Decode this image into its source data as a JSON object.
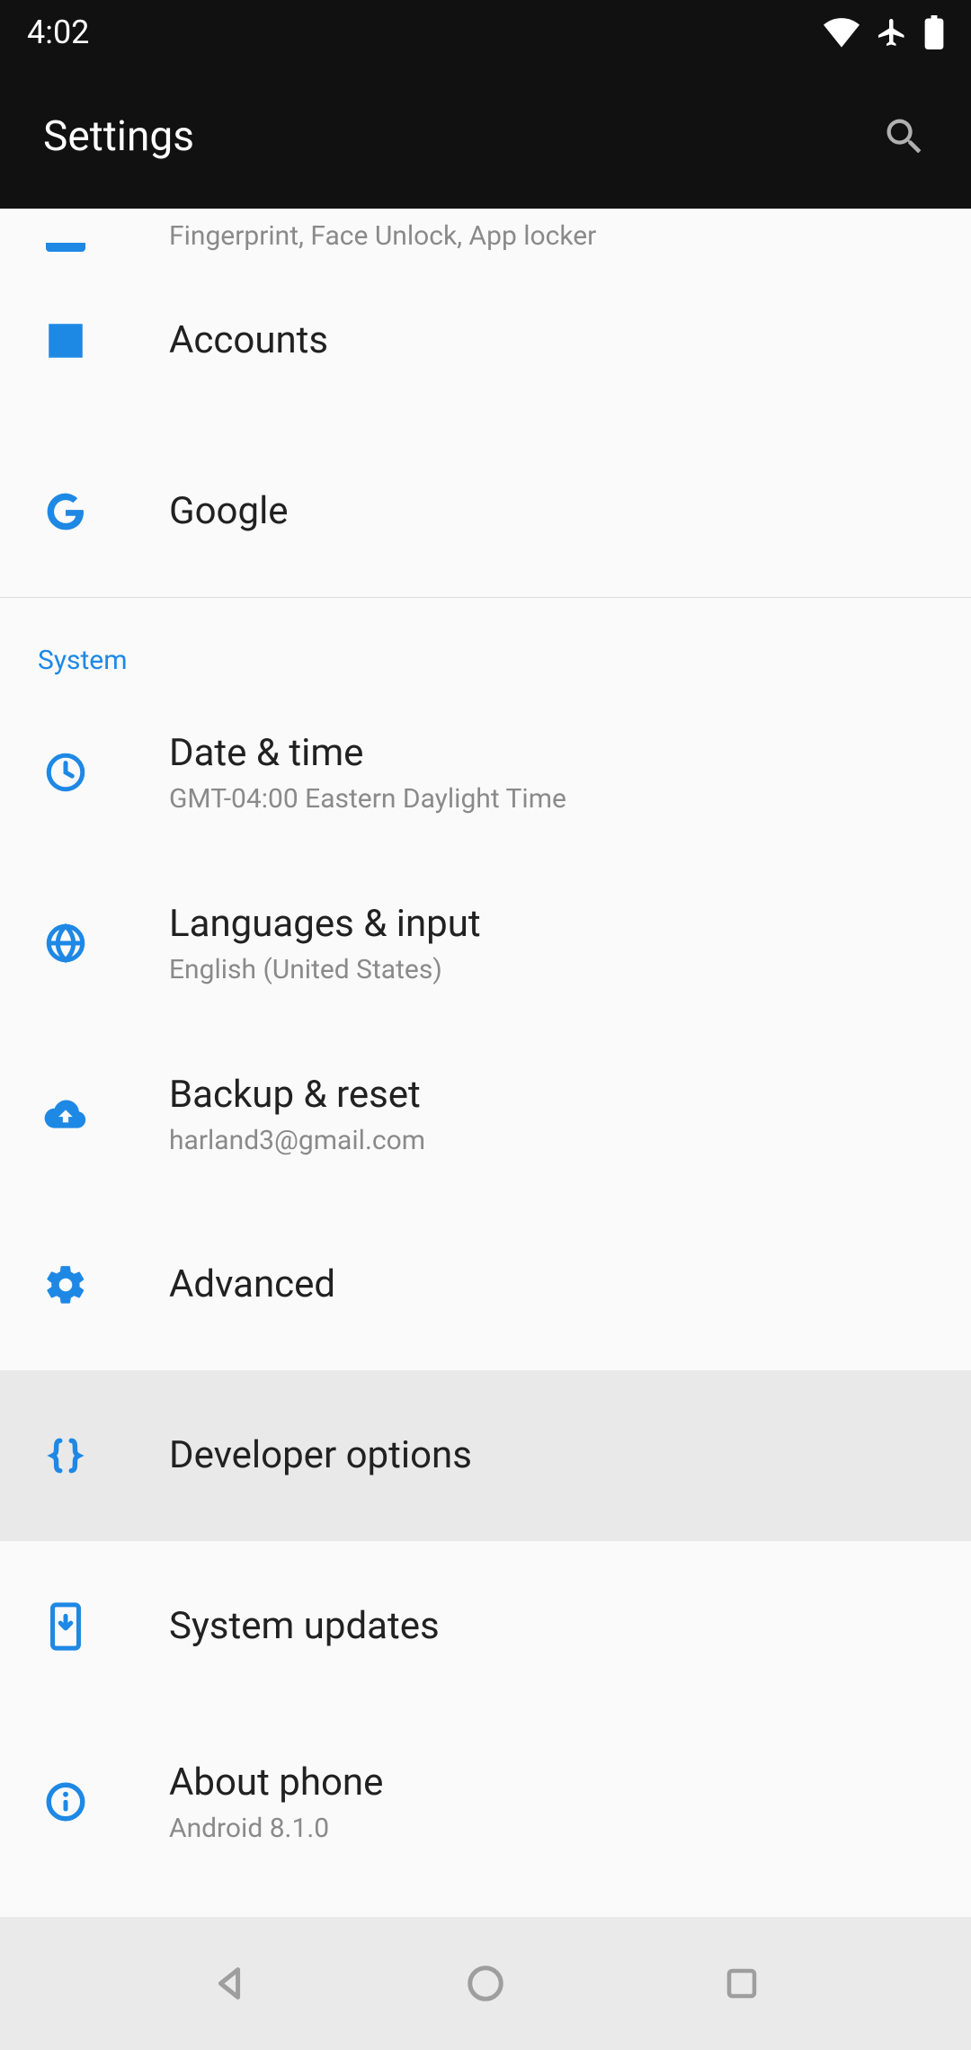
{
  "statusbar": {
    "time": "4:02"
  },
  "appbar": {
    "title": "Settings"
  },
  "partial_item": {
    "subtitle": "Fingerprint, Face Unlock, App locker"
  },
  "items": {
    "accounts": {
      "title": "Accounts"
    },
    "google": {
      "title": "Google"
    },
    "datetime": {
      "title": "Date & time",
      "subtitle": "GMT-04:00 Eastern Daylight Time"
    },
    "languages": {
      "title": "Languages & input",
      "subtitle": "English (United States)"
    },
    "backup": {
      "title": "Backup & reset",
      "subtitle": "harland3@gmail.com"
    },
    "advanced": {
      "title": "Advanced"
    },
    "developer": {
      "title": "Developer options"
    },
    "updates": {
      "title": "System updates"
    },
    "about": {
      "title": "About phone",
      "subtitle": "Android 8.1.0"
    }
  },
  "sections": {
    "system": "System"
  }
}
